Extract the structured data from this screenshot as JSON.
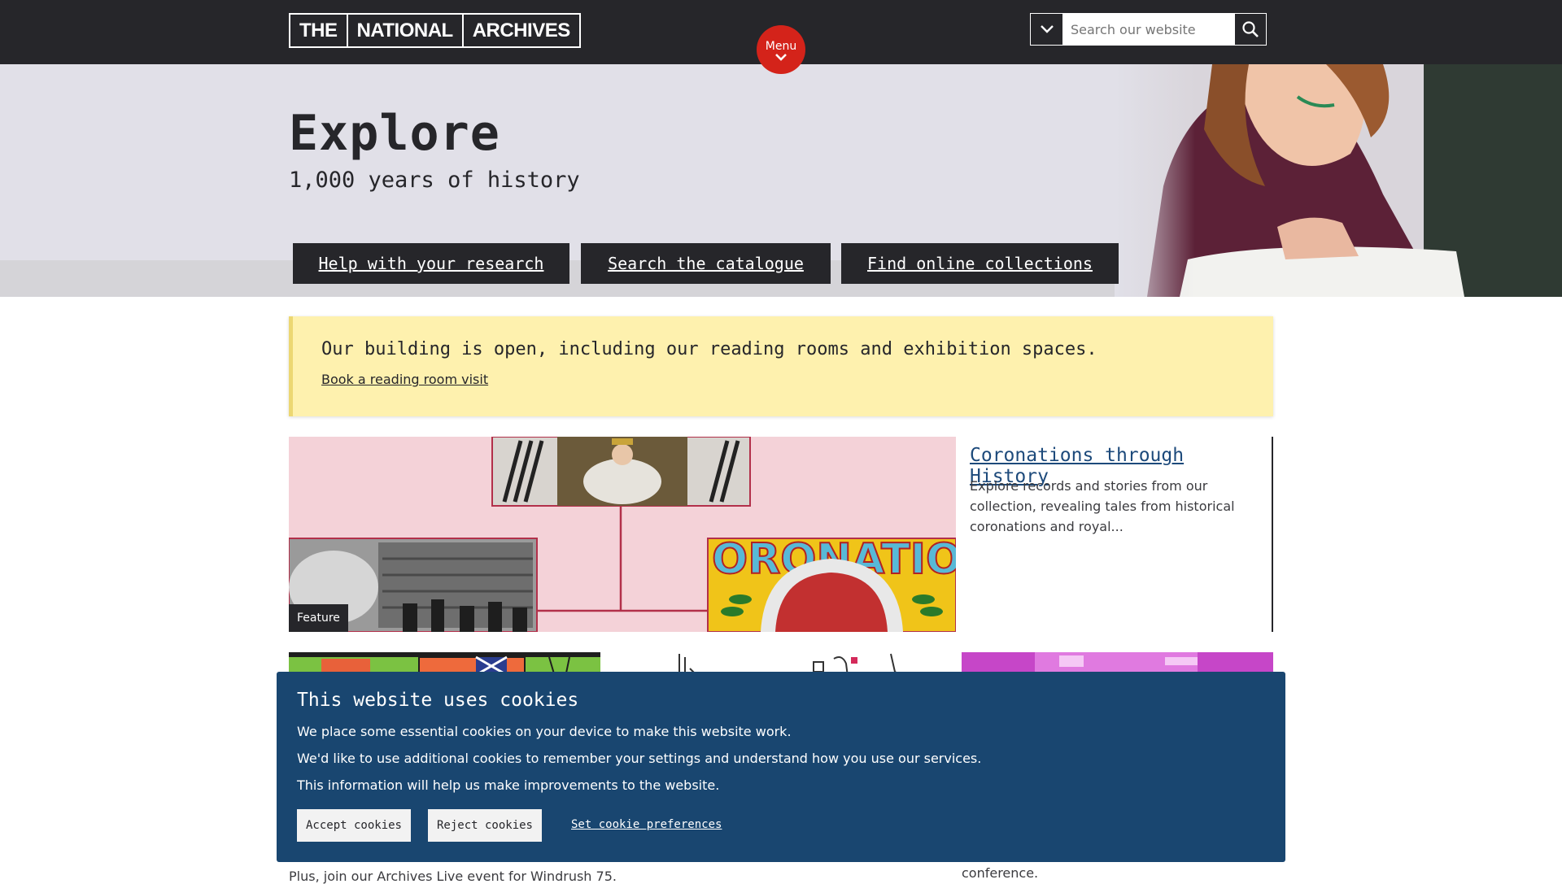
{
  "header": {
    "logo": [
      "THE",
      "NATIONAL",
      "ARCHIVES"
    ],
    "menu_label": "Menu",
    "search_placeholder": "Search our website"
  },
  "hero": {
    "title": "Explore",
    "subtitle": "1,000 years of history",
    "buttons": [
      {
        "label": "Help with your research"
      },
      {
        "label": "Search the catalogue"
      },
      {
        "label": "Find online collections"
      }
    ]
  },
  "notice": {
    "message": "Our building is open, including our reading rooms and exhibition spaces.",
    "link": "Book a reading room visit"
  },
  "feature": {
    "tag": "Feature",
    "title": "Coronations through History",
    "description": "Explore records and stories from our collection, revealing tales from historical coronations and royal...",
    "image_text": "ORONATIO"
  },
  "cards": {
    "left_text": "Plus, join our Archives Live event for Windrush 75.",
    "right_text": "conference."
  },
  "cookie": {
    "title": "This website uses cookies",
    "lines": [
      "We place some essential cookies on your device to make this website work.",
      "We'd like to use additional cookies to remember your settings and understand how you use our services.",
      "This information will help us make improvements to the website."
    ],
    "accept": "Accept cookies",
    "reject": "Reject cookies",
    "preferences": "Set cookie preferences"
  },
  "colors": {
    "header_bg": "#26262a",
    "menu_red": "#d4231a",
    "notice_bg": "#fef1ae",
    "cookie_bg": "#194670",
    "link_blue": "#1d4a7b"
  }
}
